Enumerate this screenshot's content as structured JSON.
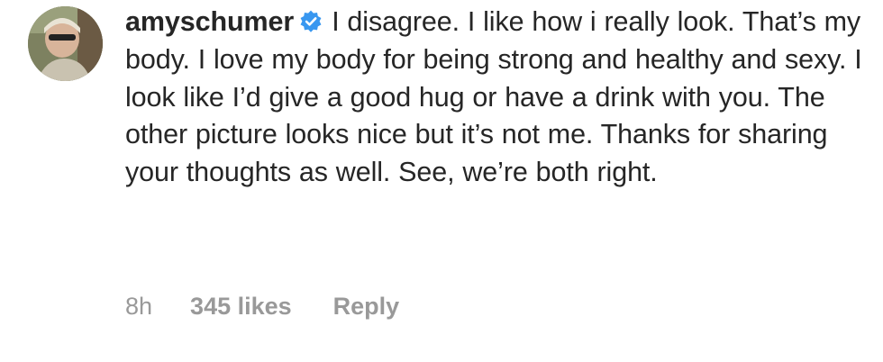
{
  "comment": {
    "username": "amyschumer",
    "verified": true,
    "verified_icon": "verified-badge-icon",
    "verified_color": "#3897f0",
    "text": "I disagree. I like how i really look. That’s my body. I love my body for being strong and healthy and sexy. I look like I’d give a good hug or have a drink with you. The other picture looks nice but it’s not me. Thanks for sharing your thoughts as well. See, we’re both right.",
    "time": "8h",
    "likes": "345 likes",
    "reply_label": "Reply"
  }
}
